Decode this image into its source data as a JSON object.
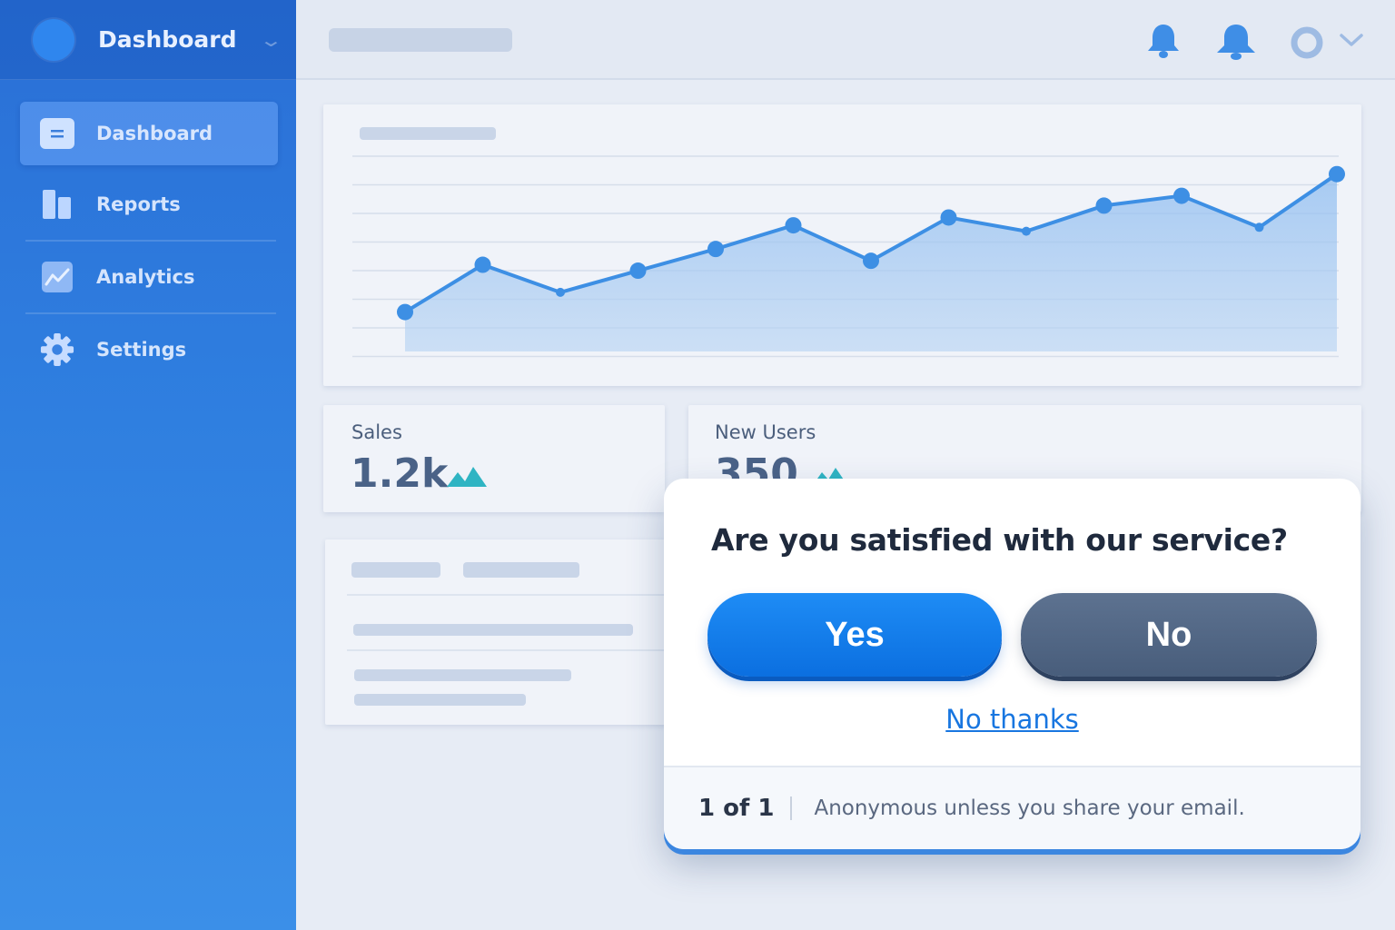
{
  "sidebar": {
    "title": "Dashboard",
    "items": [
      {
        "label": "Dashboard",
        "icon": "dashboard-icon",
        "active": true
      },
      {
        "label": "Reports",
        "icon": "reports-icon",
        "active": false
      },
      {
        "label": "Analytics",
        "icon": "analytics-icon",
        "active": false
      },
      {
        "label": "Settings",
        "icon": "gear-icon",
        "active": false
      }
    ]
  },
  "topbar": {
    "icons": [
      "bell-icon",
      "bell-icon",
      "user-icon",
      "chevron-down-icon"
    ]
  },
  "stats": [
    {
      "label": "Sales",
      "value": "1.2k",
      "trend": "up"
    },
    {
      "label": "New Users",
      "value": "350",
      "trend": "up"
    }
  ],
  "chart_data": {
    "type": "area",
    "title": "",
    "x": [
      1,
      2,
      3,
      4,
      5,
      6,
      7,
      8,
      9,
      10,
      11,
      12,
      13
    ],
    "values": [
      20,
      44,
      30,
      41,
      52,
      64,
      46,
      68,
      61,
      74,
      79,
      63,
      90
    ],
    "markers": [
      true,
      true,
      false,
      true,
      true,
      true,
      true,
      true,
      false,
      true,
      true,
      false,
      true
    ],
    "ylim": [
      0,
      100
    ],
    "grid": true
  },
  "modal": {
    "question": "Are you satisfied with our service?",
    "yes_label": "Yes",
    "no_label": "No",
    "dismiss_label": "No thanks",
    "pager": "1 of 1",
    "note": "Anonymous unless you share your email."
  },
  "colors": {
    "accent": "#1e8cf5",
    "sidebar": "#2f7fe0",
    "no_button": "#485d7b",
    "link": "#1876e0"
  }
}
